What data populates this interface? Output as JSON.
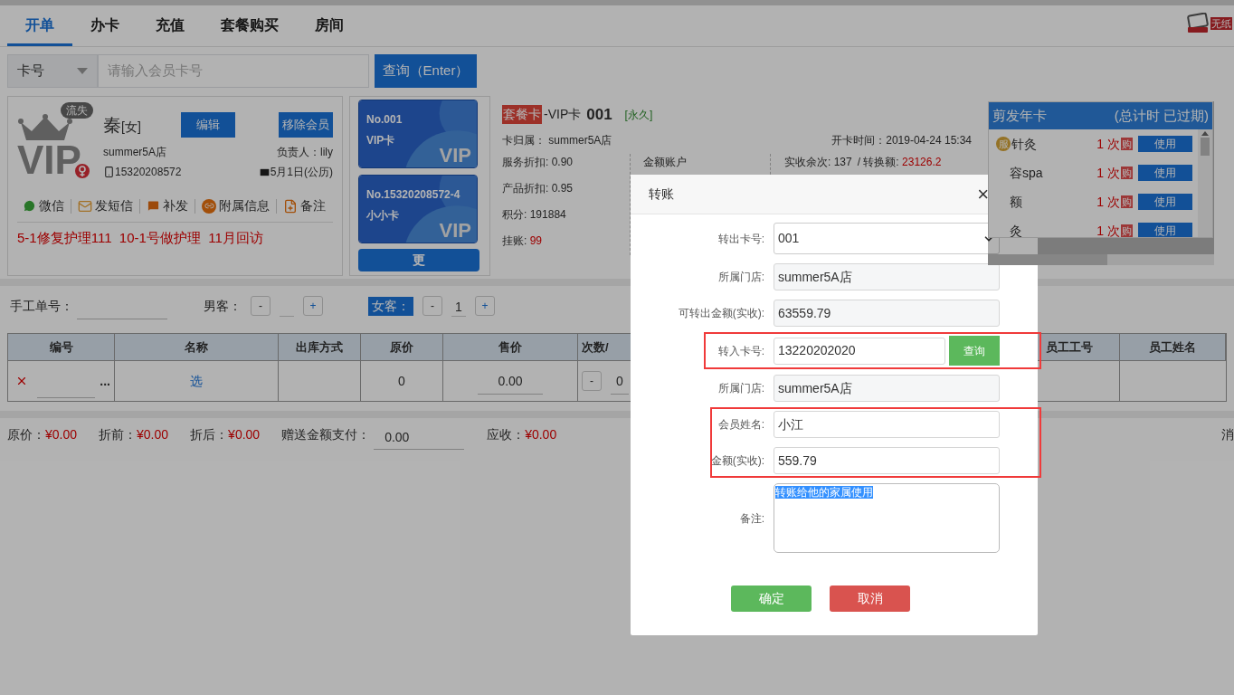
{
  "tabs": [
    {
      "label": "开单",
      "selected": true
    },
    {
      "label": "办卡",
      "selected": false
    },
    {
      "label": "充值",
      "selected": false
    },
    {
      "label": "套餐购买",
      "selected": false
    },
    {
      "label": "房间",
      "selected": false
    }
  ],
  "brand": "无纸",
  "search": {
    "type": "卡号",
    "placeholder": "请输入会员卡号",
    "button": "查询（Enter）"
  },
  "member": {
    "avatar_text": "VIP",
    "badge": "流失",
    "name": "秦",
    "gender": "[女]",
    "edit": "编辑",
    "remove": "移除会员",
    "store": "summer5A店",
    "manager": "负责人：lily",
    "phone": "15320208572",
    "birthday": "5月1日(公历)",
    "actions": [
      {
        "kind": "wechat",
        "label": "微信"
      },
      {
        "kind": "sms",
        "label": "发短信"
      },
      {
        "kind": "reissue",
        "label": "补发"
      },
      {
        "kind": "attach",
        "label": "附属信息"
      },
      {
        "kind": "note",
        "label": "备注"
      }
    ],
    "note": "5-1修复护理111  10-1号做护理  11月回访"
  },
  "cards": [
    {
      "number": "No.001",
      "name": "VIP卡",
      "mark": "VIP"
    },
    {
      "number": "No.15320208572-4",
      "name": "小小卡",
      "mark": "VIP"
    }
  ],
  "more_cards": "更",
  "card_info": {
    "tag": "套餐卡",
    "title": "-VIP卡",
    "number": "001",
    "validity": "[永久]",
    "owner_label": "卡归属：",
    "owner": "summer5A店",
    "open_time": "开卡时间：2019-04-24 15:34",
    "fields": [
      {
        "label": "服务折扣:",
        "value": "0.90",
        "alert": false
      },
      {
        "label": "产品折扣:",
        "value": "0.95",
        "alert": false
      },
      {
        "label": "积分:",
        "value": "191884",
        "alert": false
      },
      {
        "label": "挂账:",
        "value": "99",
        "alert": true
      }
    ],
    "account": "金额账户",
    "remaining": "实收余次: 137",
    "exchange_label": "/ 转换额:",
    "exchange": "23126.2"
  },
  "service_panel": {
    "title": "剪发年卡",
    "status": "(总计时 已过期)",
    "items": [
      {
        "badge": "服",
        "name": "针灸",
        "count": "1 次",
        "buy": "购",
        "use": "使用"
      },
      {
        "name": "容spa",
        "count": "1 次",
        "buy": "购",
        "use": "使用"
      },
      {
        "name": "额",
        "count": "1 次",
        "buy": "购",
        "use": "使用"
      },
      {
        "name": "灸",
        "count": "1 次",
        "buy": "购",
        "use": "使用"
      }
    ]
  },
  "guests": {
    "manual_label": "手工单号：",
    "groups": [
      {
        "label": "男客：",
        "selected": false,
        "minus": "-",
        "plus": "+"
      },
      {
        "label": "女客：",
        "selected": true,
        "minus": "-",
        "count": "1",
        "plus": "+"
      }
    ]
  },
  "table": {
    "columns": [
      "编号",
      "名称",
      "出库方式",
      "原价",
      "售价",
      "次数/",
      "员工工号",
      "员工姓名"
    ],
    "rows": [
      {
        "more": "...",
        "name": "选",
        "original_price": "0",
        "price": "0.00",
        "qty_minus": "-",
        "qty": "0"
      }
    ]
  },
  "totals": [
    {
      "label": "原价：",
      "value": "¥0.00"
    },
    {
      "label": "折前：",
      "value": "¥0.00"
    },
    {
      "label": "折后：",
      "value": "¥0.00"
    }
  ],
  "gift": {
    "label": "赠送金额支付：",
    "value": "0.00"
  },
  "receivable": {
    "label": "应收：",
    "value": "¥0.00"
  },
  "right_cut": "消",
  "dialog": {
    "title": "转账",
    "close": "×",
    "fields": [
      {
        "kind": "select",
        "label": "转出卡号:",
        "value": "001",
        "highlighted": false
      },
      {
        "kind": "readonly",
        "label": "所属门店:",
        "value": "summer5A店",
        "highlighted": false
      },
      {
        "kind": "readonly",
        "label": "可转出金额(实收):",
        "value": "63559.79",
        "highlighted": false
      },
      {
        "kind": "search",
        "label": "转入卡号:",
        "value": "13220202020",
        "button": "查询",
        "highlighted": true
      },
      {
        "kind": "readonly",
        "label": "所属门店:",
        "value": "summer5A店",
        "highlighted": false
      },
      {
        "kind": "input",
        "label": "会员姓名:",
        "value": "小江",
        "highlighted": true
      },
      {
        "kind": "input",
        "label": "金额(实收):",
        "value": "559.79",
        "highlighted": true
      },
      {
        "kind": "textarea",
        "label": "备注:",
        "value": "转账给他的家属使用",
        "highlighted": false,
        "text_selected": true
      }
    ],
    "buttons": [
      {
        "kind": "confirm",
        "label": "确定"
      },
      {
        "kind": "cancel",
        "label": "取消"
      }
    ]
  }
}
